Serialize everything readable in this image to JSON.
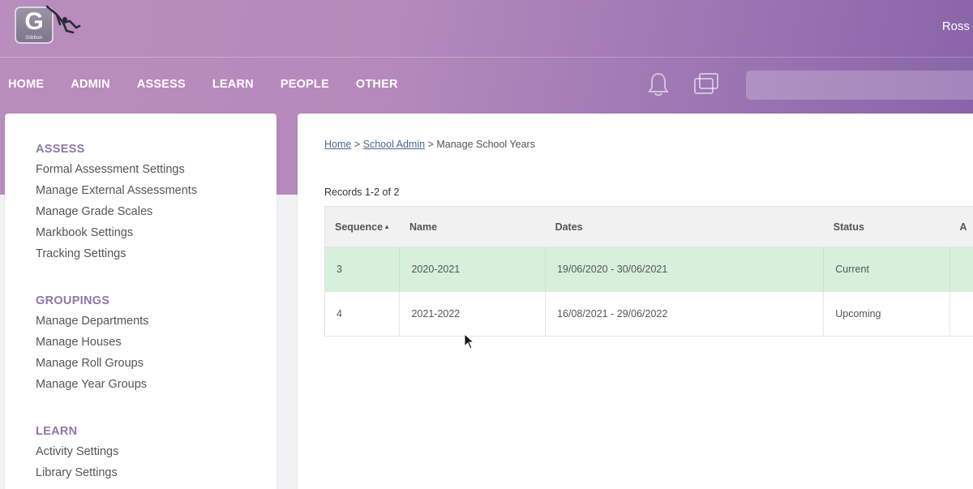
{
  "app": {
    "logo_letter": "G",
    "logo_caption": "Gibbon"
  },
  "user": {
    "name": "Ross"
  },
  "nav": {
    "items": [
      "HOME",
      "ADMIN",
      "ASSESS",
      "LEARN",
      "PEOPLE",
      "OTHER"
    ]
  },
  "search": {
    "placeholder": ""
  },
  "sidebar": {
    "sections": [
      {
        "heading": "ASSESS",
        "links": [
          "Formal Assessment Settings",
          "Manage External Assessments",
          "Manage Grade Scales",
          "Markbook Settings",
          "Tracking Settings"
        ]
      },
      {
        "heading": "GROUPINGS",
        "links": [
          "Manage Departments",
          "Manage Houses",
          "Manage Roll Groups",
          "Manage Year Groups"
        ]
      },
      {
        "heading": "LEARN",
        "links": [
          "Activity Settings",
          "Library Settings"
        ]
      }
    ]
  },
  "breadcrumb": {
    "home": "Home",
    "admin": "School Admin",
    "current": "Manage School Years",
    "sep": ">"
  },
  "records": {
    "summary": "Records 1-2 of 2"
  },
  "table": {
    "headers": {
      "sequence": "Sequence",
      "name": "Name",
      "dates": "Dates",
      "status": "Status",
      "extra": "A"
    },
    "rows": [
      {
        "sequence": "3",
        "name": "2020-2021",
        "dates": "19/06/2020 - 30/06/2021",
        "status": "Current"
      },
      {
        "sequence": "4",
        "name": "2021-2022",
        "dates": "16/08/2021 - 29/06/2022",
        "status": "Upcoming"
      }
    ]
  },
  "colors": {
    "header_start": "#b98dbd",
    "header_end": "#8863a8",
    "accent_heading": "#8d78a8",
    "current_row": "#d6f0dc"
  }
}
